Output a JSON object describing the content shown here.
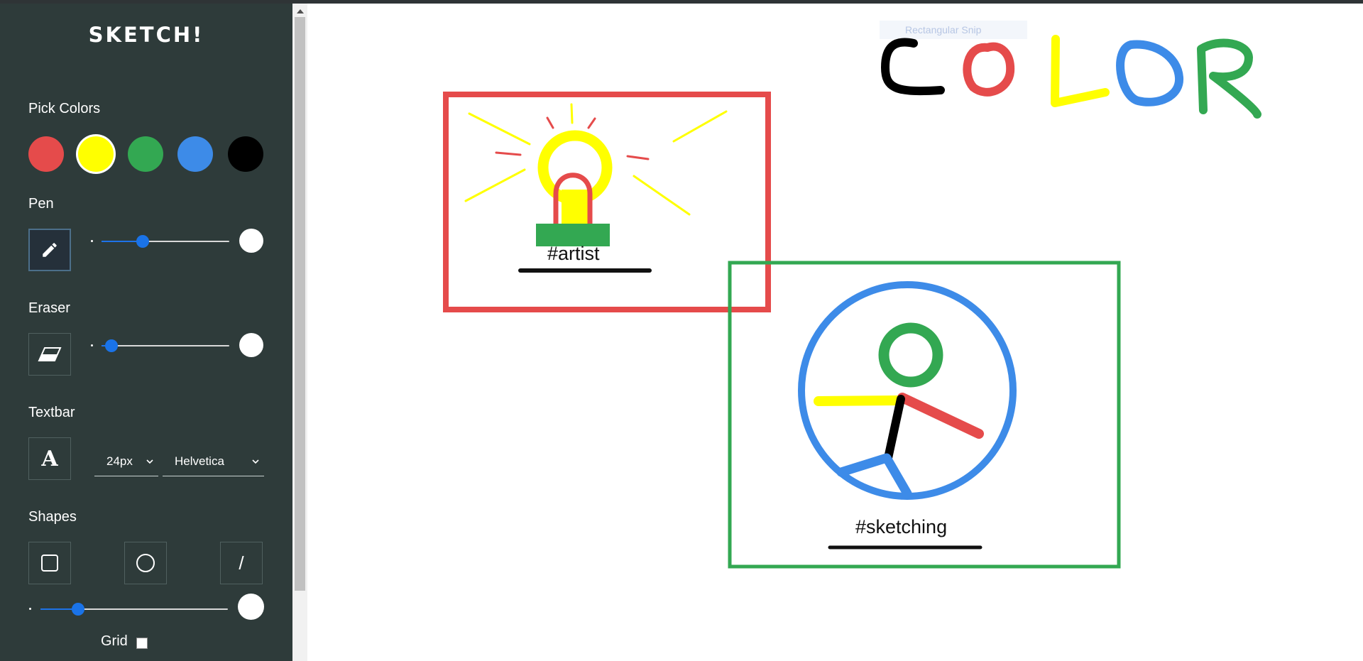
{
  "app": {
    "title": "SKETCH!"
  },
  "sidebar": {
    "colors_label": "Pick Colors",
    "colors": [
      {
        "name": "red",
        "hex": "#e54b4b",
        "selected": false
      },
      {
        "name": "yellow",
        "hex": "#ffff00",
        "selected": true
      },
      {
        "name": "green",
        "hex": "#33a852",
        "selected": false
      },
      {
        "name": "blue",
        "hex": "#3d8be8",
        "selected": false
      },
      {
        "name": "black",
        "hex": "#000000",
        "selected": false
      }
    ],
    "pen": {
      "label": "Pen",
      "icon": "pencil-icon",
      "size_fraction": 0.32
    },
    "eraser": {
      "label": "Eraser",
      "icon": "eraser-icon",
      "size_fraction": 0.08
    },
    "textbar": {
      "label": "Textbar",
      "icon_glyph": "A",
      "font_size": "24px",
      "font_family": "Helvetica"
    },
    "shapes": {
      "label": "Shapes",
      "line_glyph": "/",
      "size_fraction": 0.2
    },
    "grid": {
      "label": "Grid",
      "checked": false
    }
  },
  "canvas": {
    "tooltip": "Rectangular Snip",
    "title_letters": [
      {
        "char": "C",
        "color": "#000000"
      },
      {
        "char": "O",
        "color": "#e54b4b"
      },
      {
        "char": "L",
        "color": "#ffff00"
      },
      {
        "char": "O",
        "color": "#3d8be8"
      },
      {
        "char": "R",
        "color": "#33a852"
      }
    ],
    "tag_artist": "#artist",
    "tag_sketching": "#sketching",
    "frame_colors": {
      "red": "#e54b4b",
      "green": "#33a852"
    }
  }
}
